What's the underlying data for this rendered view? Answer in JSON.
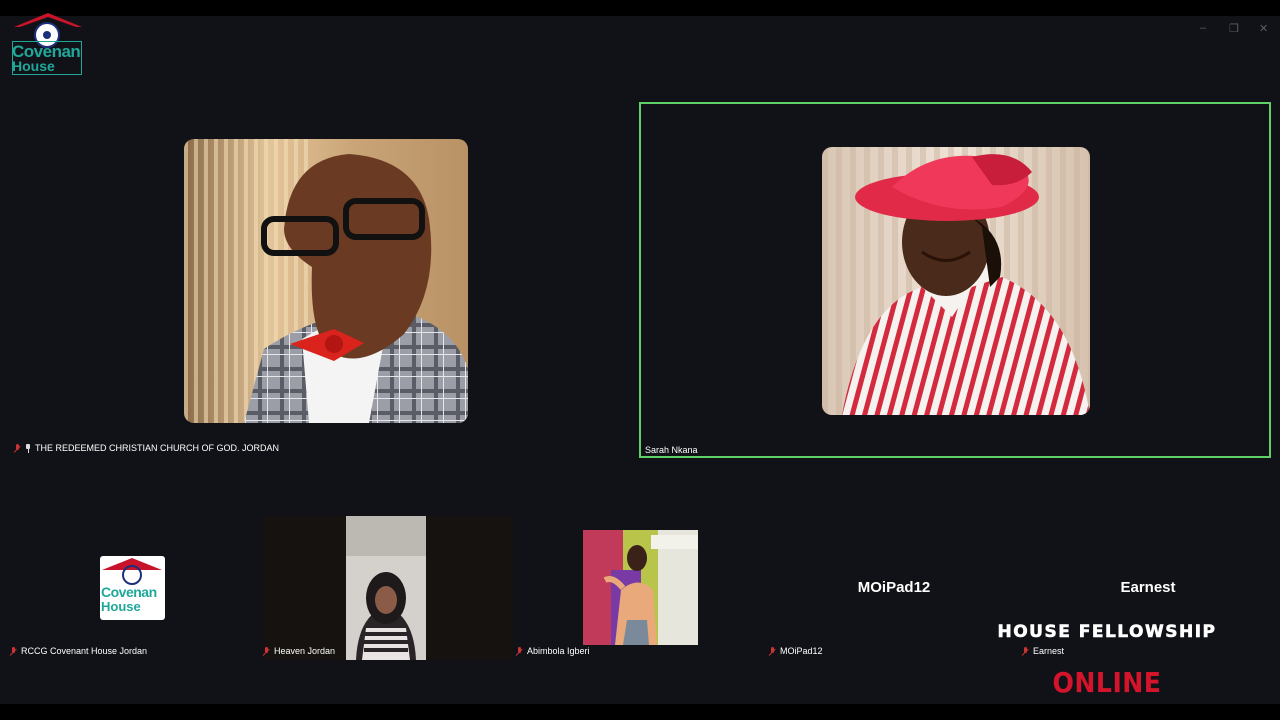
{
  "window_controls": {
    "minimize": "–",
    "restore": "❐",
    "close": "✕"
  },
  "logo": {
    "text_line1": "Covenan",
    "text_line2": "House"
  },
  "main_tiles": [
    {
      "name": "THE REDEEMED CHRISTIAN CHURCH OF GOD. JORDAN",
      "muted": true,
      "pinned": true,
      "active": false
    },
    {
      "name": "Sarah Nkana",
      "muted": false,
      "pinned": false,
      "active": true
    }
  ],
  "thumbnails": [
    {
      "name": "RCCG Covenant House Jordan",
      "muted": true
    },
    {
      "name": "Heaven Jordan",
      "muted": true
    },
    {
      "name": "Abimbola Igberi",
      "muted": true
    },
    {
      "name": "MOiPad12",
      "muted": true,
      "display_name": "MOiPad12"
    },
    {
      "name": "Earnest",
      "muted": true,
      "display_name": "Earnest"
    }
  ],
  "thumbnail_logo": {
    "text_line1": "Covenan",
    "text_line2": "House"
  },
  "banner": {
    "line1": "HOUSE FELLOWSHIP",
    "line2": "ONLINE"
  },
  "colors": {
    "active_speaker_border": "#5fd068",
    "muted_icon": "#cc3333",
    "banner_red": "#d4142a",
    "logo_teal": "#1fa89a"
  }
}
